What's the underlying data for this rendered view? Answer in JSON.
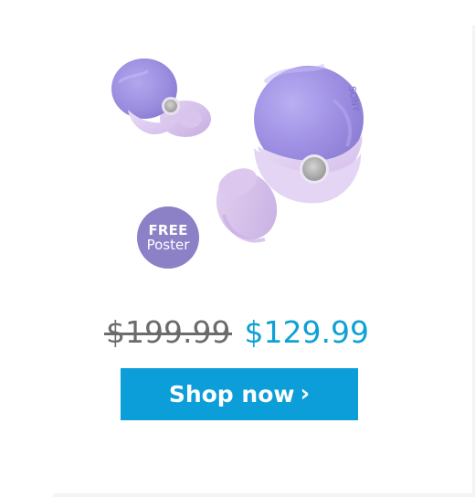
{
  "promo": {
    "badge_line1": "FREE",
    "badge_line2": "Poster",
    "old_price": "$199.99",
    "new_price": "$129.99",
    "button_label": "Shop now",
    "button_chevron": "›",
    "product_icon": "earbuds-image"
  },
  "colors": {
    "accent": "#0b9ed8",
    "price_accent": "#0ea1d5",
    "badge": "#8c80c7",
    "earbud_lavender": "#c8b4e6",
    "earbud_purple": "#9e8fe0"
  }
}
